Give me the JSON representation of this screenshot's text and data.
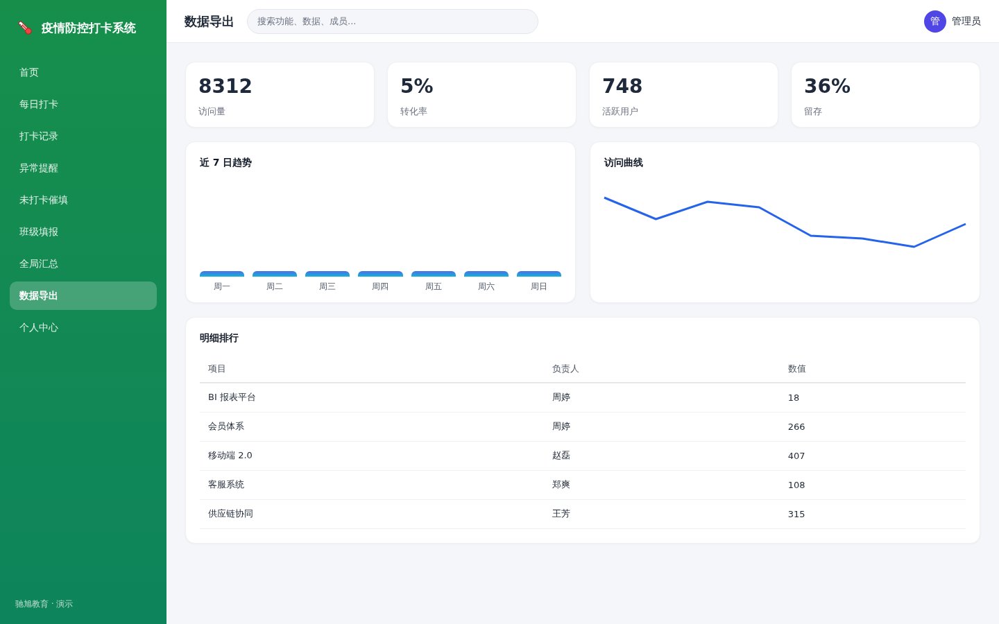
{
  "sidebar": {
    "logo_title": "疫情防控打卡系统",
    "items": [
      {
        "label": "首页",
        "selected": false
      },
      {
        "label": "每日打卡",
        "selected": false
      },
      {
        "label": "打卡记录",
        "selected": false
      },
      {
        "label": "异常提醒",
        "selected": false
      },
      {
        "label": "未打卡催填",
        "selected": false
      },
      {
        "label": "班级填报",
        "selected": false
      },
      {
        "label": "全局汇总",
        "selected": false
      },
      {
        "label": "数据导出",
        "selected": true
      },
      {
        "label": "个人中心",
        "selected": false
      }
    ],
    "footer": "驰旭教育 · 演示"
  },
  "header": {
    "title": "数据导出",
    "search": {
      "placeholder": "搜索功能、数据、成员..."
    },
    "user": {
      "avatar": "管",
      "name": "管理员"
    }
  },
  "stats": [
    {
      "value": "8312",
      "label": "访问量"
    },
    {
      "value": "5%",
      "label": "转化率"
    },
    {
      "value": "748",
      "label": "活跃用户"
    },
    {
      "value": "36%",
      "label": "留存"
    }
  ],
  "trend_card": {
    "title": "近 7 日趋势",
    "bar_labels": [
      "周一",
      "周二",
      "周三",
      "周四",
      "周五",
      "周六",
      "周日"
    ]
  },
  "curve_card": {
    "title": "访问曲线"
  },
  "table": {
    "title": "明细排行",
    "columns": [
      "项目",
      "负责人",
      "数值"
    ],
    "rows": [
      [
        "BI 报表平台",
        "周婷",
        "18"
      ],
      [
        "会员体系",
        "周婷",
        "266"
      ],
      [
        "移动端 2.0",
        "赵磊",
        "407"
      ],
      [
        "客服系统",
        "郑爽",
        "108"
      ],
      [
        "供应链协同",
        "王芳",
        "315"
      ]
    ]
  }
}
